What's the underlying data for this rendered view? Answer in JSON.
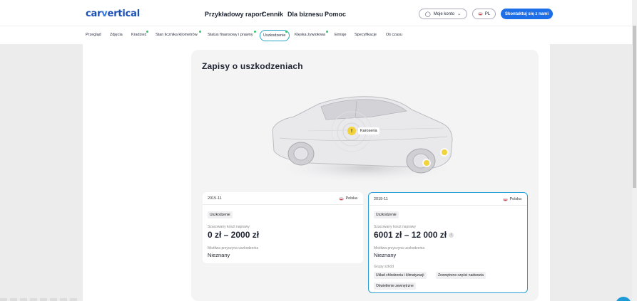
{
  "header": {
    "logo": {
      "part1": "car",
      "part2": "v",
      "part3": "ertical"
    },
    "nav": [
      "Przykładowy raport",
      "Cennik",
      "Dla biznesu",
      "Pomoc"
    ],
    "account_label": "Moje konto",
    "lang_label": "PL",
    "contact_label": "Skontaktuj się z nami"
  },
  "subnav": {
    "items": [
      "Przegląd",
      "Zdjęcia",
      "Kradzież",
      "Stan licznika kilometrów",
      "Status finansowy i prawny",
      "Uszkodzenie",
      "Klęska żywiołowa",
      "Emisje",
      "Specyfikacje",
      "Oś czasu"
    ],
    "active": "Uszkodzenie"
  },
  "section": {
    "title": "Zapisy o uszkodzeniach",
    "car_tag": "Karoseria"
  },
  "cards": [
    {
      "date": "2015-11",
      "country": "Polska",
      "chip": "Uszkodzenie",
      "cost_label": "Szacowany koszt naprawy",
      "cost_value": "0 zł – 2000 zł",
      "cause_label": "Możliwa przyczyna uszkodzenia",
      "cause_value": "Nieznany"
    },
    {
      "date": "2019-11",
      "country": "Polska",
      "chip": "Uszkodzenie",
      "cost_label": "Szacowany koszt naprawy",
      "cost_value": "6001 zł – 12 000 zł",
      "cause_label": "Możliwa przyczyna uszkodzenia",
      "cause_value": "Nieznany",
      "groups_label": "Grupy szkód",
      "groups": [
        "Układ chłodzenia i klimatyzacji",
        "Zewnętrzne części nadwozia",
        "Oświetlenie zewnętrzne"
      ]
    }
  ],
  "colors": {
    "brand": "#1a4fb8",
    "contact_button": "#1e6ee8",
    "active_border": "#2a9fd3",
    "marker": "#f2d33b"
  }
}
